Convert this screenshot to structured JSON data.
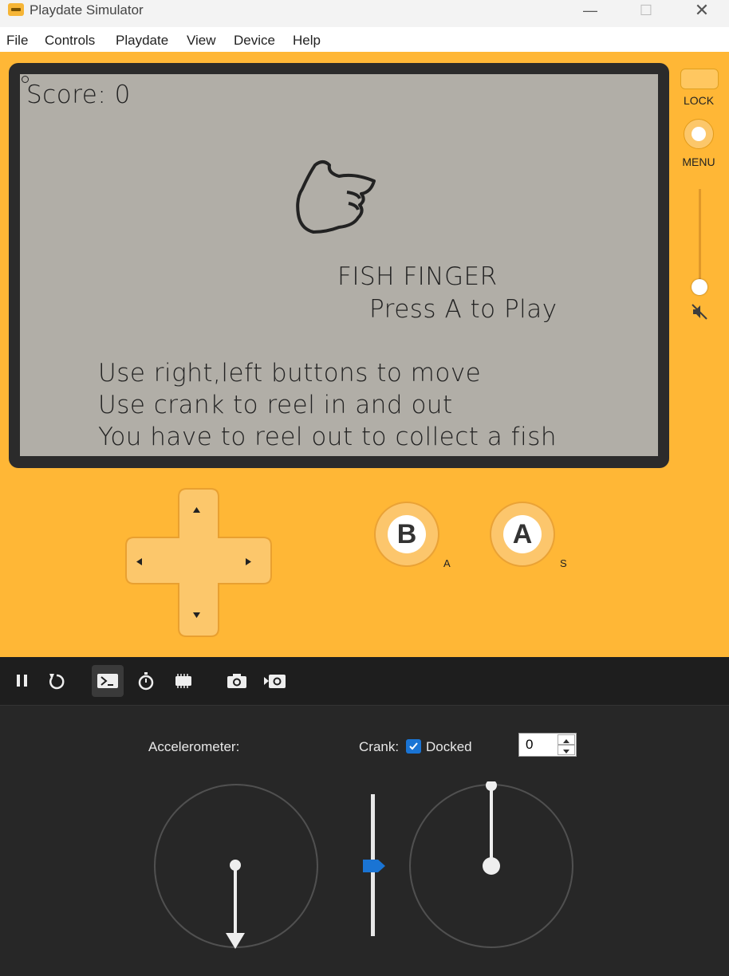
{
  "window": {
    "title": "Playdate Simulator"
  },
  "menu": [
    "File",
    "Controls",
    "Playdate",
    "View",
    "Device",
    "Help"
  ],
  "screen": {
    "score": "Score: 0",
    "title": "FISH FINGER",
    "press": "Press A to Play",
    "instructions": [
      "Use right,left buttons to move",
      "Use crank to reel in and out",
      "You have to reel out to collect a fish"
    ]
  },
  "side": {
    "lock": "LOCK",
    "menu": "MENU",
    "volume": 0.0
  },
  "buttons": {
    "b": "B",
    "a": "A",
    "b_key": "A",
    "a_key": "S"
  },
  "panel": {
    "accelerometer_label": "Accelerometer:",
    "crank_label": "Crank:",
    "docked_label": "Docked",
    "docked": true,
    "crank_value": "0"
  },
  "colors": {
    "device": "#ffb736",
    "screen": "#b1aea7",
    "bezel": "#2b2b2b",
    "panel": "#272727",
    "accent": "#1a74d4"
  }
}
